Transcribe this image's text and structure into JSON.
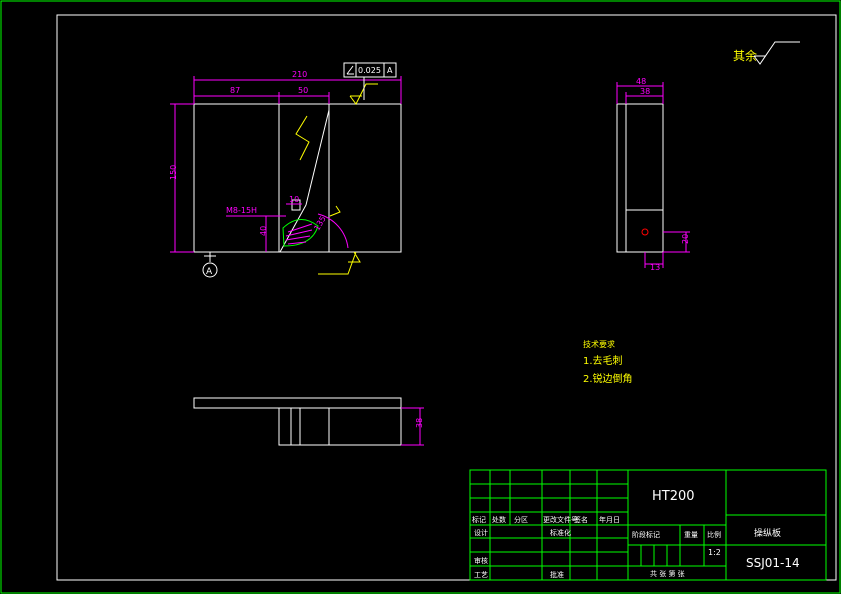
{
  "colors": {
    "background": "#000000",
    "frame": "#ffffff",
    "title_block": "#00ff00",
    "dimension": "#ff00ff",
    "annotation": "#ffff00",
    "text": "#ffffff"
  },
  "surface_finish": {
    "label": "其余"
  },
  "front_view": {
    "dim_total_width": "210",
    "dim_left_width": "87",
    "dim_slot_width": "50",
    "dim_height": "150",
    "dim_slot_depth": "40",
    "dim_small": "10",
    "dim_thread": "M8-15H",
    "dim_angle": "135",
    "tolerance_value": "0.025",
    "tolerance_datum": "A",
    "datum_label": "A"
  },
  "side_view": {
    "dim_total": "48",
    "dim_inner": "38",
    "dim_hole_x": "13",
    "dim_hole_y": "20"
  },
  "bottom_view": {
    "dim_thickness": "38"
  },
  "notes": {
    "title": "技术要求",
    "item1": "1.去毛刺",
    "item2": "2.锐边倒角"
  },
  "title_block": {
    "material": "HT200",
    "part_name": "操纵板",
    "drawing_number": "SSJ01-14",
    "scale": "1:2",
    "headers": {
      "mark": "标记",
      "count": "处数",
      "zone": "分区",
      "change_doc": "更改文件号",
      "signature": "签名",
      "date": "年月日",
      "designer": "设计",
      "standardization": "标准化",
      "stage_mark": "阶段标记",
      "weight": "重量",
      "scale_label": "比例",
      "checker": "审核",
      "process": "工艺",
      "approve": "批准",
      "sheets": "共 张 第 张"
    }
  }
}
